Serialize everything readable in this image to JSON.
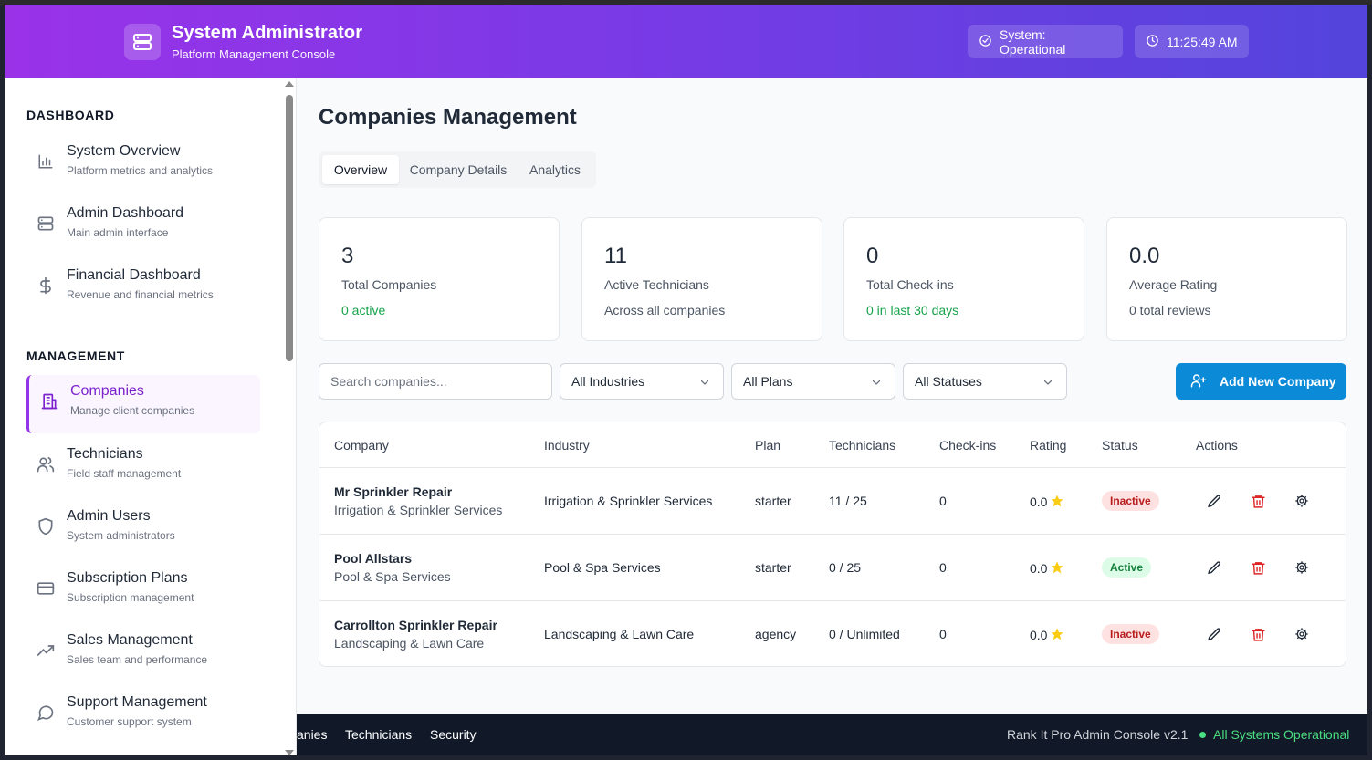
{
  "header": {
    "title": "System Administrator",
    "subtitle": "Platform Management Console",
    "status_label": "System: Operational",
    "clock": "11:25:49 AM"
  },
  "sidebar": {
    "sections": [
      {
        "title": "DASHBOARD",
        "items": [
          {
            "label": "System Overview",
            "sub": "Platform metrics and analytics",
            "icon": "bar-chart-icon"
          },
          {
            "label": "Admin Dashboard",
            "sub": "Main admin interface",
            "icon": "server-icon"
          },
          {
            "label": "Financial Dashboard",
            "sub": "Revenue and financial metrics",
            "icon": "dollar-icon"
          }
        ]
      },
      {
        "title": "MANAGEMENT",
        "items": [
          {
            "label": "Companies",
            "sub": "Manage client companies",
            "icon": "building-icon",
            "active": true
          },
          {
            "label": "Technicians",
            "sub": "Field staff management",
            "icon": "users-icon"
          },
          {
            "label": "Admin Users",
            "sub": "System administrators",
            "icon": "shield-icon"
          },
          {
            "label": "Subscription Plans",
            "sub": "Subscription management",
            "icon": "credit-card-icon"
          },
          {
            "label": "Sales Management",
            "sub": "Sales team and performance",
            "icon": "trending-up-icon"
          },
          {
            "label": "Support Management",
            "sub": "Customer support system",
            "icon": "chat-icon"
          }
        ]
      }
    ]
  },
  "main": {
    "title": "Companies Management",
    "tabs": [
      {
        "label": "Overview",
        "active": true
      },
      {
        "label": "Company Details"
      },
      {
        "label": "Analytics"
      }
    ],
    "stats": [
      {
        "value": "3",
        "label": "Total Companies",
        "sub": "0 active",
        "sub_color": "green"
      },
      {
        "value": "11",
        "label": "Active Technicians",
        "sub": "Across all companies"
      },
      {
        "value": "0",
        "label": "Total Check-ins",
        "sub": "0 in last 30 days",
        "sub_color": "green"
      },
      {
        "value": "0.0",
        "label": "Average Rating",
        "sub": "0 total reviews"
      }
    ],
    "filters": {
      "search_placeholder": "Search companies...",
      "industry": "All Industries",
      "plan": "All Plans",
      "status": "All Statuses",
      "add_button": "Add New Company"
    },
    "table": {
      "headers": [
        "Company",
        "Industry",
        "Plan",
        "Technicians",
        "Check-ins",
        "Rating",
        "Status",
        "Actions"
      ],
      "rows": [
        {
          "name": "Mr Sprinkler Repair",
          "sub_industry": "Irrigation & Sprinkler Services",
          "industry": "Irrigation & Sprinkler Services",
          "plan": "starter",
          "technicians": "11 / 25",
          "checkins": "0",
          "rating": "0.0",
          "status": "Inactive"
        },
        {
          "name": "Pool Allstars",
          "sub_industry": "Pool & Spa Services",
          "industry": "Pool & Spa Services",
          "plan": "starter",
          "technicians": "0 / 25",
          "checkins": "0",
          "rating": "0.0",
          "status": "Active"
        },
        {
          "name": "Carrollton Sprinkler Repair",
          "sub_industry": "Landscaping & Lawn Care",
          "industry": "Landscaping & Lawn Care",
          "plan": "agency",
          "technicians": "0 / Unlimited",
          "checkins": "0",
          "rating": "0.0",
          "status": "Inactive"
        }
      ]
    }
  },
  "footer": {
    "links": [
      "anies",
      "Technicians",
      "Security"
    ],
    "version": "Rank It Pro Admin Console v2.1",
    "status": "All Systems Operational"
  },
  "colors": {
    "accent_purple": "#9333ea",
    "primary_blue": "#0b8ad8",
    "success_green": "#16a34a",
    "danger_red": "#dc2626",
    "star_yellow": "#facc15"
  }
}
